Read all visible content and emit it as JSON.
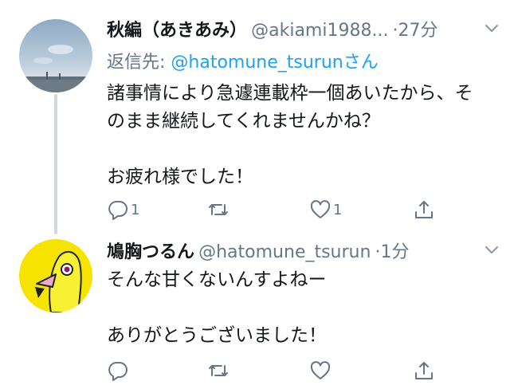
{
  "tweets": [
    {
      "name": "秋編（あきあみ）",
      "handle": "@akiami1988...",
      "time": "27分",
      "reply_prefix": "返信先: ",
      "reply_target": "@hatomune_tsurun",
      "reply_suffix": "さん",
      "lines": [
        "諸事情により急遽連載枠一個あいたから、そ",
        "のまま継続してくれませんかね？",
        "",
        "お疲れ様でした！"
      ],
      "reply_count": "1",
      "like_count": "1"
    },
    {
      "name": "鳩胸つるん",
      "handle": "@hatomune_tsurun",
      "time": "1分",
      "lines": [
        "そんな甘くないんすよねー",
        "",
        "ありがとうございました！"
      ]
    }
  ],
  "separator": "·",
  "icons": {
    "caret": "chevron-down-icon",
    "reply": "reply-icon",
    "retweet": "retweet-icon",
    "like": "heart-icon",
    "share": "share-icon"
  },
  "colors": {
    "text": "#14171a",
    "secondary": "#657786",
    "link": "#1da1f2",
    "thread_line": "#cfd8df"
  }
}
